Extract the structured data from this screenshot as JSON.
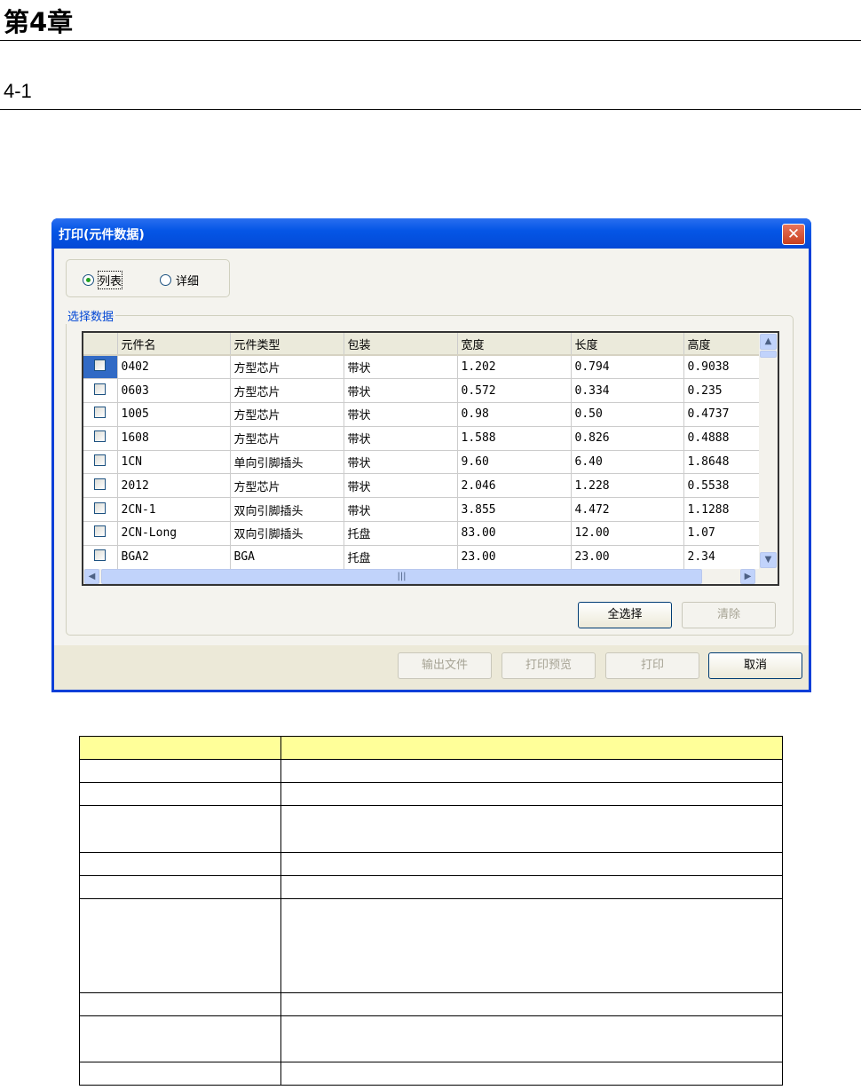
{
  "page": {
    "chapter_title": "第4章",
    "section_title": "4-1"
  },
  "dialog": {
    "title": "打印(元件数据)",
    "close_icon": "close-icon",
    "view_mode": {
      "options": [
        "列表",
        "详细"
      ],
      "selected": "列表"
    },
    "group_label": "选择数据",
    "columns": [
      "元件名",
      "元件类型",
      "包装",
      "宽度",
      "长度",
      "高度"
    ],
    "rows": [
      {
        "checked": false,
        "cells": [
          "0402",
          "方型芯片",
          "带状",
          "1.202",
          "0.794",
          "0.9038"
        ]
      },
      {
        "checked": false,
        "cells": [
          "0603",
          "方型芯片",
          "带状",
          "0.572",
          "0.334",
          "0.235"
        ]
      },
      {
        "checked": false,
        "cells": [
          "1005",
          "方型芯片",
          "带状",
          "0.98",
          "0.50",
          "0.4737"
        ]
      },
      {
        "checked": false,
        "cells": [
          "1608",
          "方型芯片",
          "带状",
          "1.588",
          "0.826",
          "0.4888"
        ]
      },
      {
        "checked": false,
        "cells": [
          "1CN",
          "单向引脚插头",
          "带状",
          "9.60",
          "6.40",
          "1.8648"
        ]
      },
      {
        "checked": false,
        "cells": [
          "2012",
          "方型芯片",
          "带状",
          "2.046",
          "1.228",
          "0.5538"
        ]
      },
      {
        "checked": false,
        "cells": [
          "2CN-1",
          "双向引脚插头",
          "带状",
          "3.855",
          "4.472",
          "1.1288"
        ]
      },
      {
        "checked": false,
        "cells": [
          "2CN-Long",
          "双向引脚插头",
          "托盘",
          "83.00",
          "12.00",
          "1.07"
        ]
      },
      {
        "checked": false,
        "cells": [
          "BGA2",
          "BGA",
          "托盘",
          "23.00",
          "23.00",
          "2.34"
        ]
      }
    ],
    "select_all_label": "全选择",
    "clear_label": "清除",
    "export_label": "输出文件",
    "preview_label": "打印预览",
    "print_label": "打印",
    "cancel_label": "取消",
    "colors": {
      "title_bar": "#0556e6",
      "header_fill": "#ffff99"
    }
  }
}
